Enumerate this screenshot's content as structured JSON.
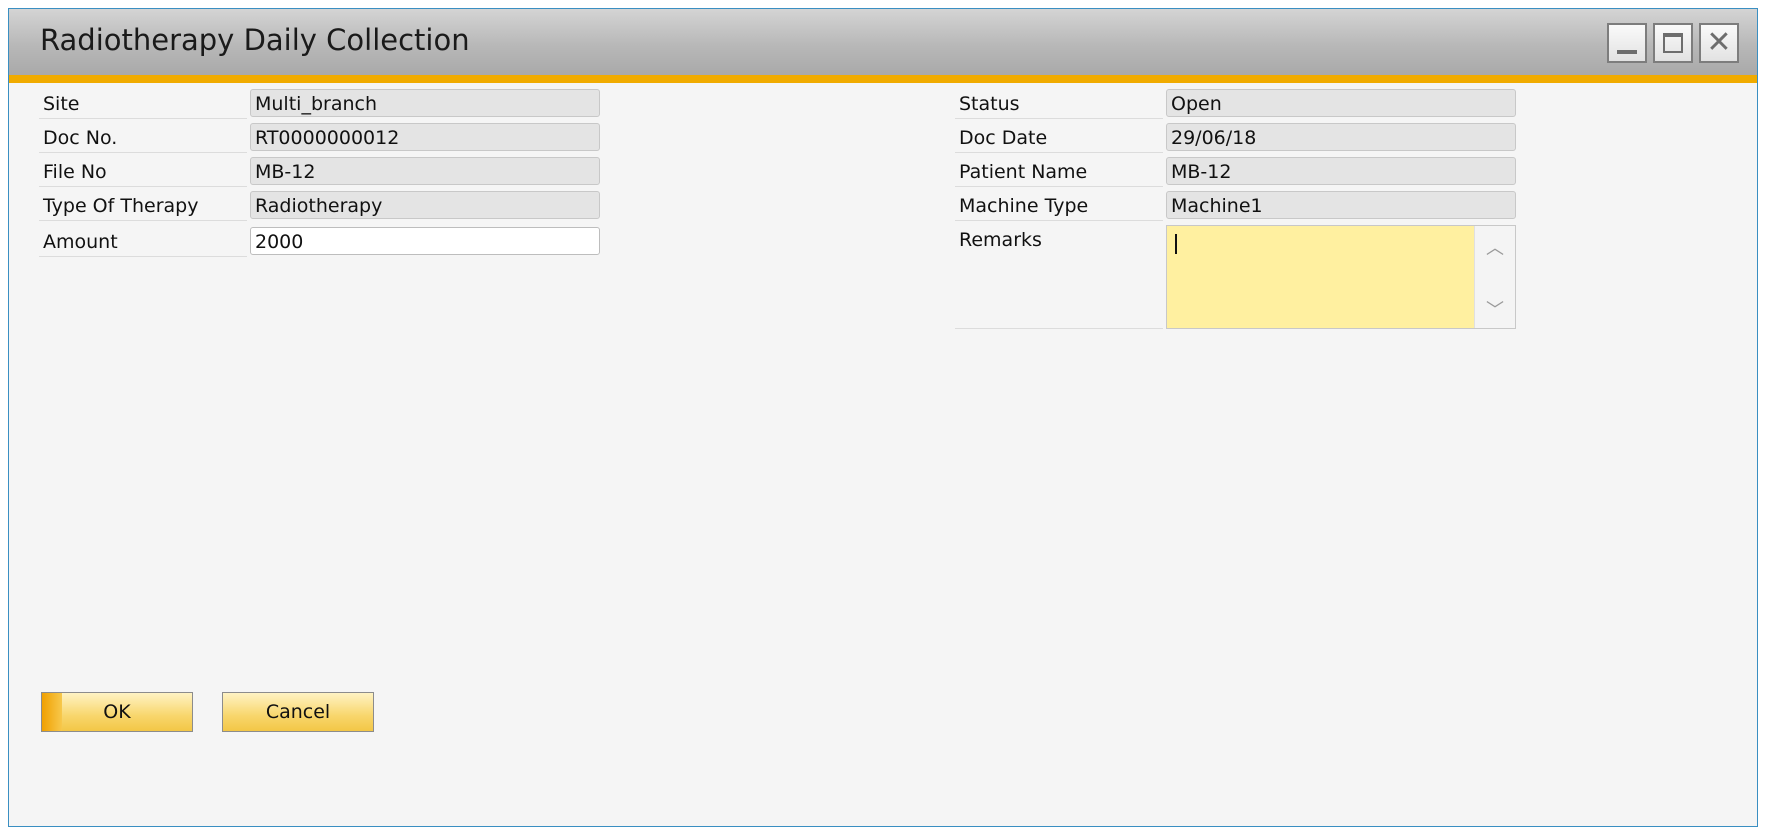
{
  "window": {
    "title": "Radiotherapy Daily Collection"
  },
  "left_fields": [
    {
      "label": "Site",
      "value": "Multi_branch"
    },
    {
      "label": "Doc No.",
      "value": "RT0000000012"
    },
    {
      "label": "File No",
      "value": "MB-12"
    },
    {
      "label": "Type Of Therapy",
      "value": "Radiotherapy"
    },
    {
      "label": "Amount",
      "value": "2000"
    }
  ],
  "right_fields": [
    {
      "label": "Status",
      "value": "Open"
    },
    {
      "label": "Doc Date",
      "value": "29/06/18"
    },
    {
      "label": "Patient Name",
      "value": "MB-12"
    },
    {
      "label": "Machine Type",
      "value": "Machine1"
    }
  ],
  "remarks": {
    "label": "Remarks",
    "value": ""
  },
  "buttons": {
    "ok": "OK",
    "cancel": "Cancel"
  },
  "colors": {
    "accent": "#f0ab00",
    "remarks_bg": "#fff0a0"
  }
}
